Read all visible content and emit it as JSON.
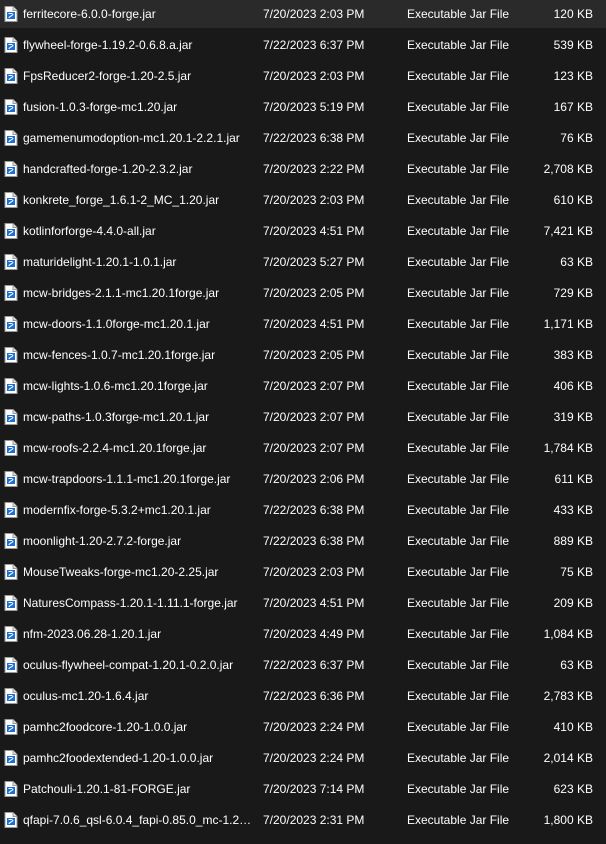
{
  "colors": {
    "background": "#191919",
    "text": "#ffffff",
    "icon_page": "#ffffff",
    "icon_accent": "#1f6fd1"
  },
  "row_icon": "jar-file-icon",
  "files": [
    {
      "name": "ferritecore-6.0.0-forge.jar",
      "date": "7/20/2023 2:03 PM",
      "type": "Executable Jar File",
      "size": "120 KB"
    },
    {
      "name": "flywheel-forge-1.19.2-0.6.8.a.jar",
      "date": "7/22/2023 6:37 PM",
      "type": "Executable Jar File",
      "size": "539 KB"
    },
    {
      "name": "FpsReducer2-forge-1.20-2.5.jar",
      "date": "7/20/2023 2:03 PM",
      "type": "Executable Jar File",
      "size": "123 KB"
    },
    {
      "name": "fusion-1.0.3-forge-mc1.20.jar",
      "date": "7/20/2023 5:19 PM",
      "type": "Executable Jar File",
      "size": "167 KB"
    },
    {
      "name": "gamemenumodoption-mc1.20.1-2.2.1.jar",
      "date": "7/22/2023 6:38 PM",
      "type": "Executable Jar File",
      "size": "76 KB"
    },
    {
      "name": "handcrafted-forge-1.20-2.3.2.jar",
      "date": "7/20/2023 2:22 PM",
      "type": "Executable Jar File",
      "size": "2,708 KB"
    },
    {
      "name": "konkrete_forge_1.6.1-2_MC_1.20.jar",
      "date": "7/20/2023 2:03 PM",
      "type": "Executable Jar File",
      "size": "610 KB"
    },
    {
      "name": "kotlinforforge-4.4.0-all.jar",
      "date": "7/20/2023 4:51 PM",
      "type": "Executable Jar File",
      "size": "7,421 KB"
    },
    {
      "name": "maturidelight-1.20.1-1.0.1.jar",
      "date": "7/20/2023 5:27 PM",
      "type": "Executable Jar File",
      "size": "63 KB"
    },
    {
      "name": "mcw-bridges-2.1.1-mc1.20.1forge.jar",
      "date": "7/20/2023 2:05 PM",
      "type": "Executable Jar File",
      "size": "729 KB"
    },
    {
      "name": "mcw-doors-1.1.0forge-mc1.20.1.jar",
      "date": "7/20/2023 4:51 PM",
      "type": "Executable Jar File",
      "size": "1,171 KB"
    },
    {
      "name": "mcw-fences-1.0.7-mc1.20.1forge.jar",
      "date": "7/20/2023 2:05 PM",
      "type": "Executable Jar File",
      "size": "383 KB"
    },
    {
      "name": "mcw-lights-1.0.6-mc1.20.1forge.jar",
      "date": "7/20/2023 2:07 PM",
      "type": "Executable Jar File",
      "size": "406 KB"
    },
    {
      "name": "mcw-paths-1.0.3forge-mc1.20.1.jar",
      "date": "7/20/2023 2:07 PM",
      "type": "Executable Jar File",
      "size": "319 KB"
    },
    {
      "name": "mcw-roofs-2.2.4-mc1.20.1forge.jar",
      "date": "7/20/2023 2:07 PM",
      "type": "Executable Jar File",
      "size": "1,784 KB"
    },
    {
      "name": "mcw-trapdoors-1.1.1-mc1.20.1forge.jar",
      "date": "7/20/2023 2:06 PM",
      "type": "Executable Jar File",
      "size": "611 KB"
    },
    {
      "name": "modernfix-forge-5.3.2+mc1.20.1.jar",
      "date": "7/22/2023 6:38 PM",
      "type": "Executable Jar File",
      "size": "433 KB"
    },
    {
      "name": "moonlight-1.20-2.7.2-forge.jar",
      "date": "7/22/2023 6:38 PM",
      "type": "Executable Jar File",
      "size": "889 KB"
    },
    {
      "name": "MouseTweaks-forge-mc1.20-2.25.jar",
      "date": "7/20/2023 2:03 PM",
      "type": "Executable Jar File",
      "size": "75 KB"
    },
    {
      "name": "NaturesCompass-1.20.1-1.11.1-forge.jar",
      "date": "7/20/2023 4:51 PM",
      "type": "Executable Jar File",
      "size": "209 KB"
    },
    {
      "name": "nfm-2023.06.28-1.20.1.jar",
      "date": "7/20/2023 4:49 PM",
      "type": "Executable Jar File",
      "size": "1,084 KB"
    },
    {
      "name": "oculus-flywheel-compat-1.20.1-0.2.0.jar",
      "date": "7/22/2023 6:37 PM",
      "type": "Executable Jar File",
      "size": "63 KB"
    },
    {
      "name": "oculus-mc1.20-1.6.4.jar",
      "date": "7/22/2023 6:36 PM",
      "type": "Executable Jar File",
      "size": "2,783 KB"
    },
    {
      "name": "pamhc2foodcore-1.20-1.0.0.jar",
      "date": "7/20/2023 2:24 PM",
      "type": "Executable Jar File",
      "size": "410 KB"
    },
    {
      "name": "pamhc2foodextended-1.20-1.0.0.jar",
      "date": "7/20/2023 2:24 PM",
      "type": "Executable Jar File",
      "size": "2,014 KB"
    },
    {
      "name": "Patchouli-1.20.1-81-FORGE.jar",
      "date": "7/20/2023 7:14 PM",
      "type": "Executable Jar File",
      "size": "623 KB"
    },
    {
      "name": "qfapi-7.0.6_qsl-6.0.4_fapi-0.85.0_mc-1.20....",
      "date": "7/20/2023 2:31 PM",
      "type": "Executable Jar File",
      "size": "1,800 KB"
    }
  ]
}
